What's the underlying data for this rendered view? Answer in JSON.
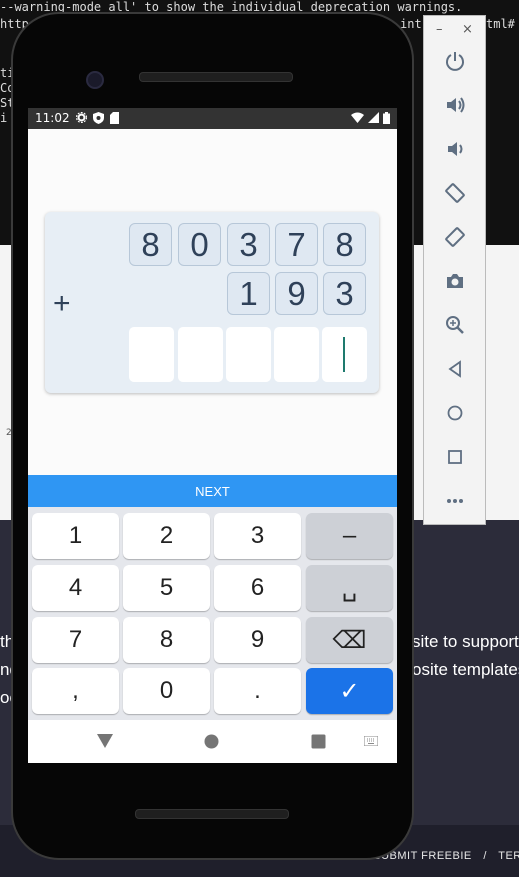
{
  "background": {
    "terminal_lines": [
      "--warning-mode all' to show the individual deprecation warnings.",
      "http",
      "int",
      "tml#",
      "ti",
      "Co",
      "St",
      "i"
    ],
    "side_text": "2",
    "web_text": [
      "th",
      "nd",
      "oo",
      "site to support",
      "osite templates"
    ],
    "footer": {
      "contact": "CONTACT OR SUBMIT FREEBIE",
      "separator": "/",
      "terms": "TERMS"
    }
  },
  "emulator_toolbar": {
    "minimize": "–",
    "close": "×",
    "buttons": [
      "power-icon",
      "volume-up-icon",
      "volume-down-icon",
      "rotate-left-icon",
      "rotate-right-icon",
      "camera-icon",
      "zoom-icon",
      "back-icon",
      "home-icon",
      "overview-icon",
      "more-icon"
    ]
  },
  "status_bar": {
    "time": "11:02"
  },
  "problem": {
    "top_digits": [
      "8",
      "0",
      "3",
      "7",
      "8"
    ],
    "bottom_digits": [
      "1",
      "9",
      "3"
    ],
    "operator": "+",
    "answer_slots": [
      "",
      "",
      "",
      "",
      ""
    ]
  },
  "next_label": "NEXT",
  "keyboard": {
    "rows": [
      [
        "1",
        "2",
        "3",
        "–"
      ],
      [
        "4",
        "5",
        "6",
        "␣"
      ],
      [
        "7",
        "8",
        "9",
        "⌫"
      ],
      [
        ",",
        "0",
        ".",
        "✓"
      ]
    ]
  },
  "colors": {
    "accent": "#2f96f3",
    "enter_key": "#1b73e8",
    "digit_text": "#2f4159",
    "card_bg": "#e7eef5",
    "cursor": "#1e7a6e"
  }
}
